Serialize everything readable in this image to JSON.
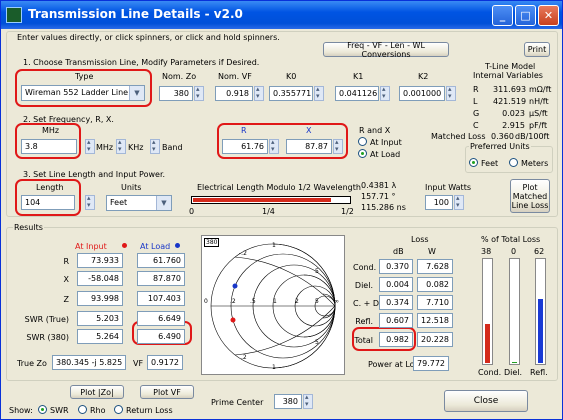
{
  "window": {
    "title": "Transmission Line Details - v2.0",
    "min": "_",
    "max": "□",
    "close": "✕"
  },
  "instructions": "Enter values directly, or click spinners, or click and hold spinners.",
  "freq_button": "Freq - VF - Len - WL Conversions",
  "print_button": "Print",
  "step1": "1. Choose Transmission Line, Modify Parameters if Desired.",
  "type": {
    "label": "Type",
    "value": "Wireman 552 Ladder Line"
  },
  "params": {
    "nom_zo_label": "Nom. Zo",
    "nom_zo": "380",
    "nom_vf_label": "Nom. VF",
    "nom_vf": "0.918",
    "k0_label": "K0",
    "k0": "0.355771",
    "k1_label": "K1",
    "k1": "0.041126",
    "k2_label": "K2",
    "k2": "0.001000"
  },
  "tline": {
    "heading1": "T-Line Model",
    "heading2": "Internal Variables",
    "rows": [
      {
        "sym": "R",
        "val": "311.693",
        "unit": "mΩ/ft"
      },
      {
        "sym": "L",
        "val": "421.519",
        "unit": "nH/ft"
      },
      {
        "sym": "G",
        "val": "0.023",
        "unit": "μS/ft"
      },
      {
        "sym": "C",
        "val": "2.915",
        "unit": "pF/ft"
      }
    ],
    "matched_loss_label": "Matched Loss",
    "matched_loss": "0.360",
    "matched_loss_unit": "dB/100ft"
  },
  "step2": "2. Set Frequency, R, X.",
  "freq": {
    "label": "MHz",
    "value": "3.8",
    "mhz": "MHz",
    "khz": "KHz",
    "band": "Band"
  },
  "rx": {
    "r_label": "R",
    "r": "61.76",
    "x_label": "X",
    "x": "87.87",
    "group": "R and X",
    "at_input": "At Input",
    "at_load": "At Load"
  },
  "units": {
    "group": "Preferred Units",
    "feet": "Feet",
    "meters": "Meters"
  },
  "step3": "3. Set Line Length and Input Power.",
  "length": {
    "label": "Length",
    "value": "104",
    "units_label": "Units",
    "units_value": "Feet"
  },
  "elec": {
    "title": "Electrical Length Modulo 1/2 Wavelength",
    "l0": "0",
    "l1": "1/4",
    "l2": "1/2",
    "fill": 0.876,
    "wl": "0.4381 λ",
    "deg": "157.71 °",
    "ns": "115.286 ns"
  },
  "watts": {
    "label": "Input Watts",
    "value": "100"
  },
  "plot_matched": "Plot Matched Line Loss",
  "results": {
    "title": "Results",
    "at_input": "At Input",
    "at_load": "At Load",
    "rows": [
      {
        "label": "R",
        "in": "73.933",
        "load": "61.760"
      },
      {
        "label": "X",
        "in": "-58.048",
        "load": "87.870"
      },
      {
        "label": "Z",
        "in": "93.998",
        "load": "107.403"
      },
      {
        "label": "SWR (True)",
        "in": "5.203",
        "load": "6.649"
      },
      {
        "label": "SWR  (380)",
        "in": "5.264",
        "load": "6.490"
      }
    ],
    "true_zo_label": "True Zo",
    "true_zo": "380.345 -j 5.825",
    "vf_label": "VF",
    "vf": "0.9172"
  },
  "smith": {
    "zo": "380",
    "labels_top": [
      "-.2",
      "-.5",
      "1",
      "2",
      "5"
    ],
    "labels_axis": [
      "0",
      ".2",
      ".5",
      "1",
      "2",
      "5",
      "∞"
    ],
    "labels_bottom": [
      ".2",
      ".5",
      "1",
      "2",
      "5"
    ]
  },
  "loss": {
    "title": "Loss",
    "db": "dB",
    "w": "W",
    "rows": [
      {
        "label": "Cond.",
        "db": "0.370",
        "w": "7.628"
      },
      {
        "label": "Diel.",
        "db": "0.004",
        "w": "0.082"
      },
      {
        "label": "C. + D.",
        "db": "0.374",
        "w": "7.710"
      },
      {
        "label": "Refl.",
        "db": "0.607",
        "w": "12.518"
      },
      {
        "label": "Total",
        "db": "0.982",
        "w": "20.228"
      }
    ],
    "power_label": "Power at Load",
    "power": "79.772"
  },
  "pct": {
    "title": "% of Total Loss",
    "cond_pct": "38",
    "diel_pct": "0",
    "refl_pct": "62",
    "cond": "Cond.",
    "diel": "Diel.",
    "refl": "Refl.",
    "cond_v": 0.38,
    "diel_v": 0.004,
    "refl_v": 0.62,
    "cond_color": "#d42a1a",
    "diel_color": "#23a023",
    "refl_color": "#1a3ad4"
  },
  "plot_zo": "Plot |Zo|",
  "plot_vf": "Plot VF",
  "prime_label": "Prime Center",
  "prime": "380",
  "show": {
    "label": "Show:",
    "swr": "SWR",
    "rho": "Rho",
    "rl": "Return Loss"
  },
  "close": "Close"
}
